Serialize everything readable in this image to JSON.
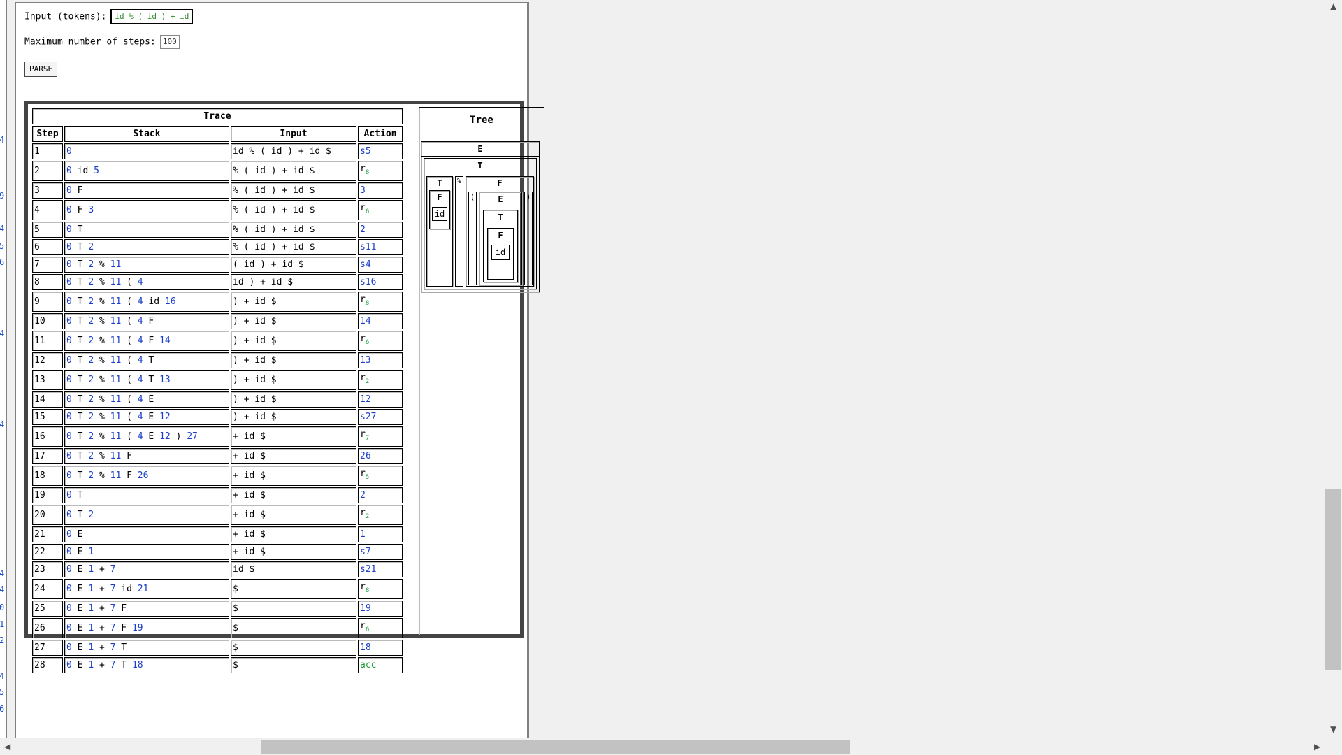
{
  "form": {
    "input_label": "Input (tokens):",
    "input_value": "id % ( id ) + id",
    "steps_label": "Maximum number of steps:",
    "steps_value": "100",
    "parse_button": "PARSE"
  },
  "trace": {
    "title": "Trace",
    "headers": [
      "Step",
      "Stack",
      "Input",
      "Action"
    ],
    "rows": [
      {
        "step": "1",
        "stack": [
          [
            "0",
            "s"
          ]
        ],
        "input": "id % ( id ) + id $",
        "action": "s5",
        "sub": ""
      },
      {
        "step": "2",
        "stack": [
          [
            "0",
            "s"
          ],
          [
            "id",
            "t"
          ],
          [
            "5",
            "s"
          ]
        ],
        "input": "% ( id ) + id $",
        "action": "r",
        "sub": "8"
      },
      {
        "step": "3",
        "stack": [
          [
            "0",
            "s"
          ],
          [
            "F",
            "t"
          ]
        ],
        "input": "% ( id ) + id $",
        "action": "3",
        "sub": ""
      },
      {
        "step": "4",
        "stack": [
          [
            "0",
            "s"
          ],
          [
            "F",
            "t"
          ],
          [
            "3",
            "s"
          ]
        ],
        "input": "% ( id ) + id $",
        "action": "r",
        "sub": "6"
      },
      {
        "step": "5",
        "stack": [
          [
            "0",
            "s"
          ],
          [
            "T",
            "t"
          ]
        ],
        "input": "% ( id ) + id $",
        "action": "2",
        "sub": ""
      },
      {
        "step": "6",
        "stack": [
          [
            "0",
            "s"
          ],
          [
            "T",
            "t"
          ],
          [
            "2",
            "s"
          ]
        ],
        "input": "% ( id ) + id $",
        "action": "s11",
        "sub": ""
      },
      {
        "step": "7",
        "stack": [
          [
            "0",
            "s"
          ],
          [
            "T",
            "t"
          ],
          [
            "2",
            "s"
          ],
          [
            "%",
            "t"
          ],
          [
            "11",
            "s"
          ]
        ],
        "input": "( id ) + id $",
        "action": "s4",
        "sub": ""
      },
      {
        "step": "8",
        "stack": [
          [
            "0",
            "s"
          ],
          [
            "T",
            "t"
          ],
          [
            "2",
            "s"
          ],
          [
            "%",
            "t"
          ],
          [
            "11",
            "s"
          ],
          [
            "(",
            "t"
          ],
          [
            "4",
            "s"
          ]
        ],
        "input": "id ) + id $",
        "action": "s16",
        "sub": ""
      },
      {
        "step": "9",
        "stack": [
          [
            "0",
            "s"
          ],
          [
            "T",
            "t"
          ],
          [
            "2",
            "s"
          ],
          [
            "%",
            "t"
          ],
          [
            "11",
            "s"
          ],
          [
            "(",
            "t"
          ],
          [
            "4",
            "s"
          ],
          [
            "id",
            "t"
          ],
          [
            "16",
            "s"
          ]
        ],
        "input": ") + id $",
        "action": "r",
        "sub": "8"
      },
      {
        "step": "10",
        "stack": [
          [
            "0",
            "s"
          ],
          [
            "T",
            "t"
          ],
          [
            "2",
            "s"
          ],
          [
            "%",
            "t"
          ],
          [
            "11",
            "s"
          ],
          [
            "(",
            "t"
          ],
          [
            "4",
            "s"
          ],
          [
            "F",
            "t"
          ]
        ],
        "input": ") + id $",
        "action": "14",
        "sub": ""
      },
      {
        "step": "11",
        "stack": [
          [
            "0",
            "s"
          ],
          [
            "T",
            "t"
          ],
          [
            "2",
            "s"
          ],
          [
            "%",
            "t"
          ],
          [
            "11",
            "s"
          ],
          [
            "(",
            "t"
          ],
          [
            "4",
            "s"
          ],
          [
            "F",
            "t"
          ],
          [
            "14",
            "s"
          ]
        ],
        "input": ") + id $",
        "action": "r",
        "sub": "6"
      },
      {
        "step": "12",
        "stack": [
          [
            "0",
            "s"
          ],
          [
            "T",
            "t"
          ],
          [
            "2",
            "s"
          ],
          [
            "%",
            "t"
          ],
          [
            "11",
            "s"
          ],
          [
            "(",
            "t"
          ],
          [
            "4",
            "s"
          ],
          [
            "T",
            "t"
          ]
        ],
        "input": ") + id $",
        "action": "13",
        "sub": ""
      },
      {
        "step": "13",
        "stack": [
          [
            "0",
            "s"
          ],
          [
            "T",
            "t"
          ],
          [
            "2",
            "s"
          ],
          [
            "%",
            "t"
          ],
          [
            "11",
            "s"
          ],
          [
            "(",
            "t"
          ],
          [
            "4",
            "s"
          ],
          [
            "T",
            "t"
          ],
          [
            "13",
            "s"
          ]
        ],
        "input": ") + id $",
        "action": "r",
        "sub": "2"
      },
      {
        "step": "14",
        "stack": [
          [
            "0",
            "s"
          ],
          [
            "T",
            "t"
          ],
          [
            "2",
            "s"
          ],
          [
            "%",
            "t"
          ],
          [
            "11",
            "s"
          ],
          [
            "(",
            "t"
          ],
          [
            "4",
            "s"
          ],
          [
            "E",
            "t"
          ]
        ],
        "input": ") + id $",
        "action": "12",
        "sub": ""
      },
      {
        "step": "15",
        "stack": [
          [
            "0",
            "s"
          ],
          [
            "T",
            "t"
          ],
          [
            "2",
            "s"
          ],
          [
            "%",
            "t"
          ],
          [
            "11",
            "s"
          ],
          [
            "(",
            "t"
          ],
          [
            "4",
            "s"
          ],
          [
            "E",
            "t"
          ],
          [
            "12",
            "s"
          ]
        ],
        "input": ") + id $",
        "action": "s27",
        "sub": ""
      },
      {
        "step": "16",
        "stack": [
          [
            "0",
            "s"
          ],
          [
            "T",
            "t"
          ],
          [
            "2",
            "s"
          ],
          [
            "%",
            "t"
          ],
          [
            "11",
            "s"
          ],
          [
            "(",
            "t"
          ],
          [
            "4",
            "s"
          ],
          [
            "E",
            "t"
          ],
          [
            "12",
            "s"
          ],
          [
            ")",
            "t"
          ],
          [
            "27",
            "s"
          ]
        ],
        "input": "+ id $",
        "action": "r",
        "sub": "7"
      },
      {
        "step": "17",
        "stack": [
          [
            "0",
            "s"
          ],
          [
            "T",
            "t"
          ],
          [
            "2",
            "s"
          ],
          [
            "%",
            "t"
          ],
          [
            "11",
            "s"
          ],
          [
            "F",
            "t"
          ]
        ],
        "input": "+ id $",
        "action": "26",
        "sub": ""
      },
      {
        "step": "18",
        "stack": [
          [
            "0",
            "s"
          ],
          [
            "T",
            "t"
          ],
          [
            "2",
            "s"
          ],
          [
            "%",
            "t"
          ],
          [
            "11",
            "s"
          ],
          [
            "F",
            "t"
          ],
          [
            "26",
            "s"
          ]
        ],
        "input": "+ id $",
        "action": "r",
        "sub": "5"
      },
      {
        "step": "19",
        "stack": [
          [
            "0",
            "s"
          ],
          [
            "T",
            "t"
          ]
        ],
        "input": "+ id $",
        "action": "2",
        "sub": ""
      },
      {
        "step": "20",
        "stack": [
          [
            "0",
            "s"
          ],
          [
            "T",
            "t"
          ],
          [
            "2",
            "s"
          ]
        ],
        "input": "+ id $",
        "action": "r",
        "sub": "2"
      },
      {
        "step": "21",
        "stack": [
          [
            "0",
            "s"
          ],
          [
            "E",
            "t"
          ]
        ],
        "input": "+ id $",
        "action": "1",
        "sub": ""
      },
      {
        "step": "22",
        "stack": [
          [
            "0",
            "s"
          ],
          [
            "E",
            "t"
          ],
          [
            "1",
            "s"
          ]
        ],
        "input": "+ id $",
        "action": "s7",
        "sub": ""
      },
      {
        "step": "23",
        "stack": [
          [
            "0",
            "s"
          ],
          [
            "E",
            "t"
          ],
          [
            "1",
            "s"
          ],
          [
            "+",
            "t"
          ],
          [
            "7",
            "s"
          ]
        ],
        "input": "id $",
        "action": "s21",
        "sub": ""
      },
      {
        "step": "24",
        "stack": [
          [
            "0",
            "s"
          ],
          [
            "E",
            "t"
          ],
          [
            "1",
            "s"
          ],
          [
            "+",
            "t"
          ],
          [
            "7",
            "s"
          ],
          [
            "id",
            "t"
          ],
          [
            "21",
            "s"
          ]
        ],
        "input": "$",
        "action": "r",
        "sub": "8"
      },
      {
        "step": "25",
        "stack": [
          [
            "0",
            "s"
          ],
          [
            "E",
            "t"
          ],
          [
            "1",
            "s"
          ],
          [
            "+",
            "t"
          ],
          [
            "7",
            "s"
          ],
          [
            "F",
            "t"
          ]
        ],
        "input": "$",
        "action": "19",
        "sub": ""
      },
      {
        "step": "26",
        "stack": [
          [
            "0",
            "s"
          ],
          [
            "E",
            "t"
          ],
          [
            "1",
            "s"
          ],
          [
            "+",
            "t"
          ],
          [
            "7",
            "s"
          ],
          [
            "F",
            "t"
          ],
          [
            "19",
            "s"
          ]
        ],
        "input": "$",
        "action": "r",
        "sub": "6"
      },
      {
        "step": "27",
        "stack": [
          [
            "0",
            "s"
          ],
          [
            "E",
            "t"
          ],
          [
            "1",
            "s"
          ],
          [
            "+",
            "t"
          ],
          [
            "7",
            "s"
          ],
          [
            "T",
            "t"
          ]
        ],
        "input": "$",
        "action": "18",
        "sub": ""
      },
      {
        "step": "28",
        "stack": [
          [
            "0",
            "s"
          ],
          [
            "E",
            "t"
          ],
          [
            "1",
            "s"
          ],
          [
            "+",
            "t"
          ],
          [
            "7",
            "s"
          ],
          [
            "T",
            "t"
          ],
          [
            "18",
            "s"
          ]
        ],
        "input": "$",
        "action": "acc",
        "sub": ""
      }
    ]
  },
  "tree": {
    "title": "Tree",
    "nodes": {
      "root": "E",
      "t1": "T",
      "t2": "T",
      "f1": "F",
      "id1": "id",
      "mod": "%",
      "f2": "F",
      "lparen": "(",
      "e2": "E",
      "t3": "T",
      "f3": "F",
      "id2": "id",
      "rparen": ")"
    }
  },
  "left_frame_digits": [
    "4",
    "9",
    "4",
    "5",
    "6",
    "4",
    "4",
    "4",
    "4",
    "0",
    "1",
    "2",
    "4",
    "5",
    "6"
  ],
  "colors": {
    "state": "#1a3ec9",
    "accept": "#1e9e3a",
    "subscript": "#1e9e3a"
  }
}
